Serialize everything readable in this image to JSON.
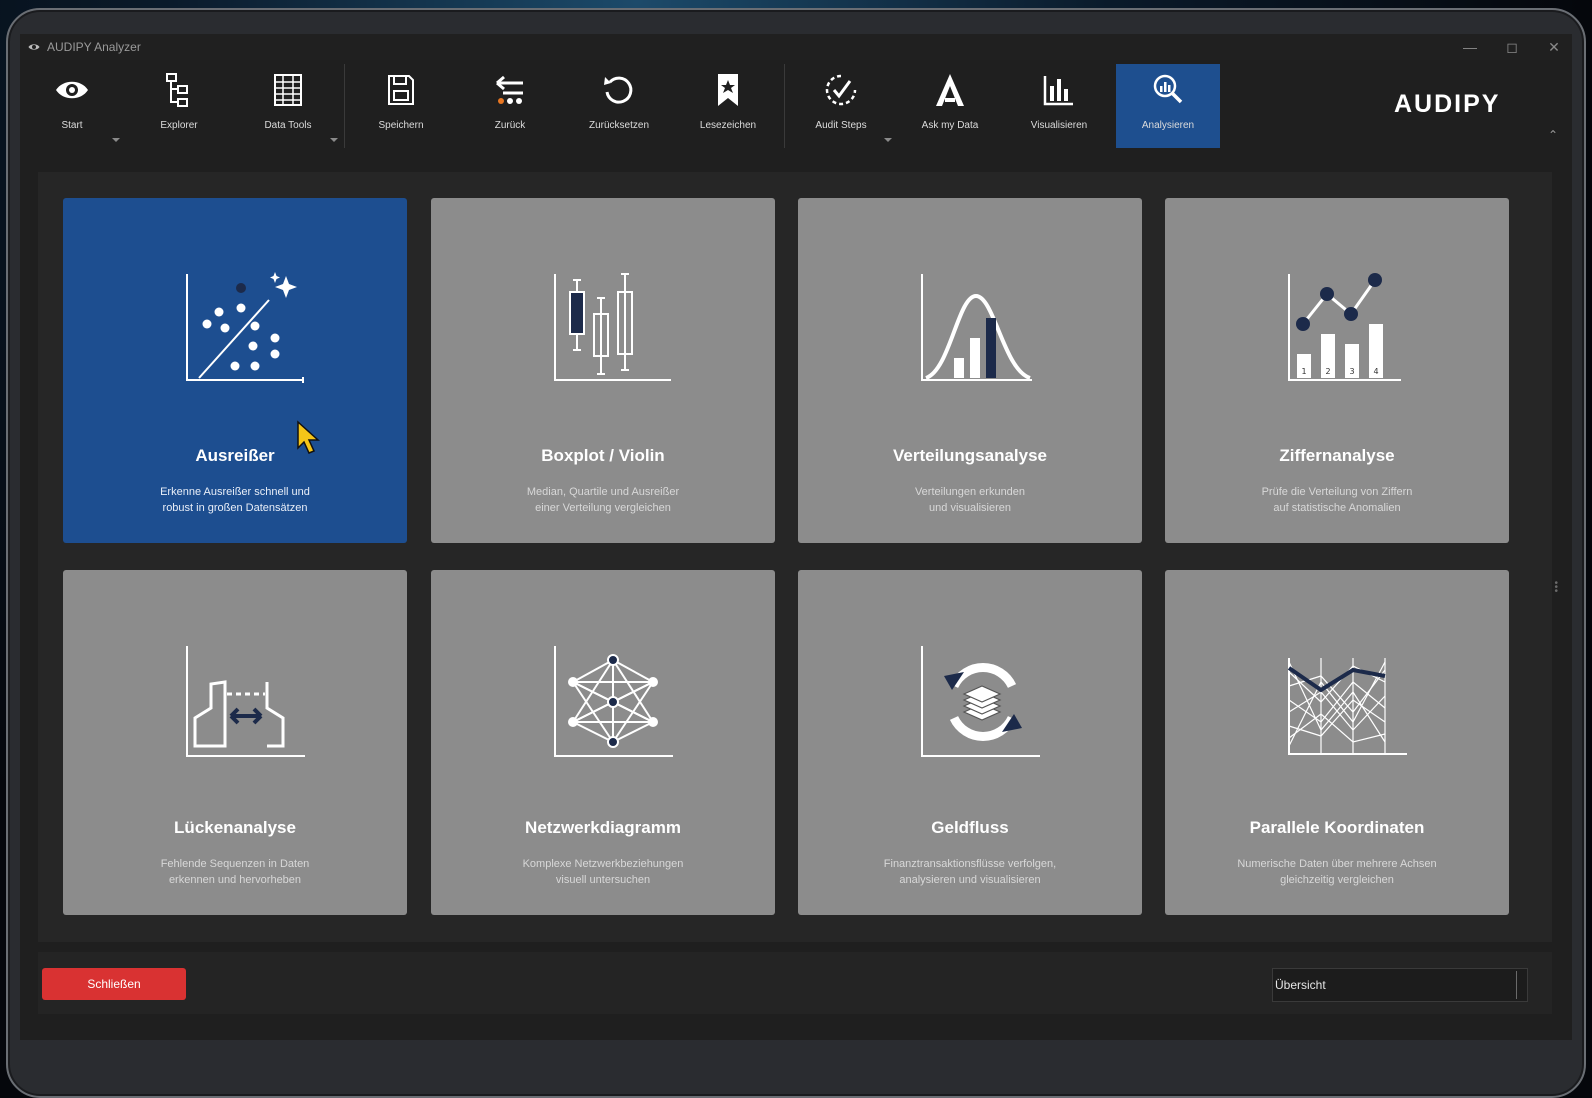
{
  "window": {
    "title": "AUDIPY Analyzer",
    "brand": "AUDIPY"
  },
  "toolbar": {
    "items": [
      {
        "label": "Start",
        "icon": "eye-icon"
      },
      {
        "label": "Explorer",
        "icon": "tree-icon"
      },
      {
        "label": "Data Tools",
        "icon": "table-icon"
      },
      {
        "label": "Speichern",
        "icon": "save-icon"
      },
      {
        "label": "Zurück",
        "icon": "back-icon"
      },
      {
        "label": "Zurücksetzen",
        "icon": "reset-icon"
      },
      {
        "label": "Lesezeichen",
        "icon": "bookmark-icon"
      },
      {
        "label": "Audit Steps",
        "icon": "audit-check-icon"
      },
      {
        "label": "Ask my Data",
        "icon": "ai-letter-icon"
      },
      {
        "label": "Visualisieren",
        "icon": "bar-chart-icon"
      },
      {
        "label": "Analysieren",
        "icon": "magnifier-chart-icon",
        "active": true
      }
    ]
  },
  "tiles": [
    {
      "title": "Ausreißer",
      "desc": "Erkenne Ausreißer schnell und\nrobust in großen Datensätzen",
      "icon": "scatter-outlier-icon",
      "selected": true
    },
    {
      "title": "Boxplot / Violin",
      "desc": "Median, Quartile und Ausreißer\neiner Verteilung vergleichen",
      "icon": "boxplot-icon"
    },
    {
      "title": "Verteilungsanalyse",
      "desc": "Verteilungen erkunden\nund visualisieren",
      "icon": "distribution-icon"
    },
    {
      "title": "Ziffernanalyse",
      "desc": "Prüfe die Verteilung von Ziffern\nauf statistische Anomalien",
      "icon": "digit-chart-icon"
    },
    {
      "title": "Lückenanalyse",
      "desc": "Fehlende Sequenzen in Daten\nerkennen und hervorheben",
      "icon": "gap-icon"
    },
    {
      "title": "Netzwerkdiagramm",
      "desc": "Komplexe Netzwerkbeziehungen\nvisuell untersuchen",
      "icon": "network-icon"
    },
    {
      "title": "Geldfluss",
      "desc": "Finanztransaktionsflüsse verfolgen,\nanalysieren und visualisieren",
      "icon": "money-flow-icon"
    },
    {
      "title": "Parallele Koordinaten",
      "desc": "Numerische Daten über mehrere Achsen\ngleichzeitig vergleichen",
      "icon": "parallel-coords-icon"
    }
  ],
  "digit_labels": [
    "1",
    "2",
    "3",
    "4"
  ],
  "footer": {
    "close_label": "Schließen",
    "overview_value": "Übersicht"
  },
  "colors": {
    "accent": "#1d4e90",
    "tile": "#8c8c8c",
    "danger": "#d93232",
    "navy": "#1c2a4a"
  }
}
